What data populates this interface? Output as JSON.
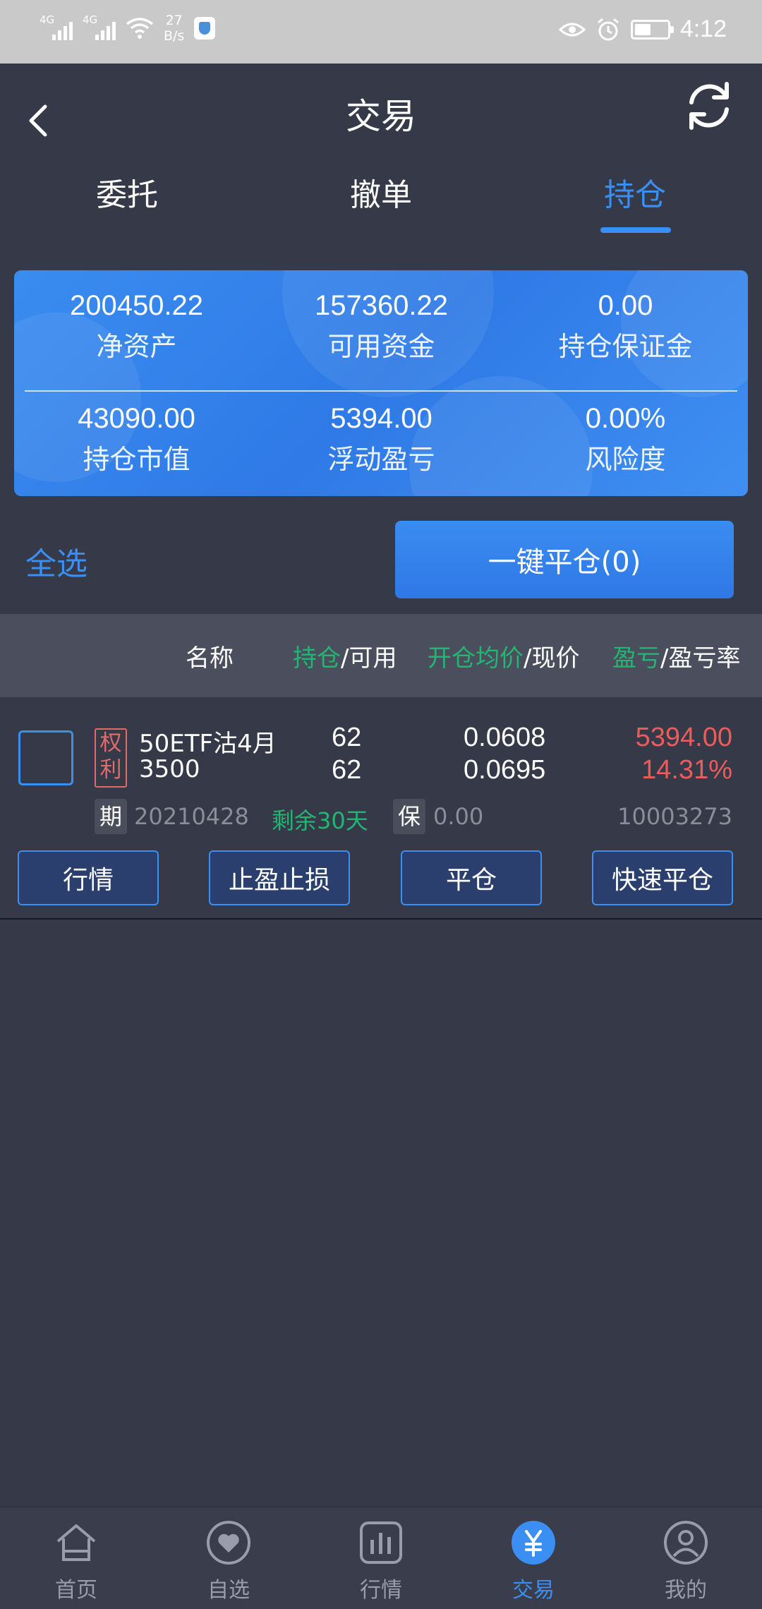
{
  "status_bar": {
    "sim1": "4G",
    "sim2": "4G",
    "net_speed_value": "27",
    "net_speed_unit": "B/s",
    "battery_level": 0.5,
    "time": "4:12"
  },
  "header": {
    "title": "交易"
  },
  "tabs": [
    {
      "label": "委托",
      "active": false
    },
    {
      "label": "撤单",
      "active": false
    },
    {
      "label": "持仓",
      "active": true
    }
  ],
  "summary": {
    "net_assets": {
      "value": "200450.22",
      "label": "净资产"
    },
    "available_funds": {
      "value": "157360.22",
      "label": "可用资金"
    },
    "position_margin": {
      "value": "0.00",
      "label": "持仓保证金"
    },
    "market_value": {
      "value": "43090.00",
      "label": "持仓市值"
    },
    "floating_pnl": {
      "value": "5394.00",
      "label": "浮动盈亏"
    },
    "risk_level": {
      "value": "0.00%",
      "label": "风险度"
    }
  },
  "actions": {
    "select_all": "全选",
    "close_all": "一键平仓(0)"
  },
  "table_header": {
    "name": "名称",
    "position_green": "持仓",
    "position_rest": "/可用",
    "open_avg_green": "开仓均价",
    "open_avg_rest": "/现价",
    "pnl_green": "盈亏",
    "pnl_rest": "/盈亏率"
  },
  "positions": [
    {
      "type_tag": [
        "权",
        "利"
      ],
      "name_line1": "50ETF沽4月",
      "name_line2": "3500",
      "holding": "62",
      "available": "62",
      "open_avg_price": "0.0608",
      "current_price": "0.0695",
      "pnl": "5394.00",
      "pnl_rate": "14.31%",
      "expiry_tag": "期",
      "expiry_date": "20210428",
      "days_left": "剩余30天",
      "margin_tag": "保",
      "margin": "0.00",
      "contract_code": "10003273",
      "buttons": [
        "行情",
        "止盈止损",
        "平仓",
        "快速平仓"
      ]
    }
  ],
  "bottom_nav": [
    {
      "label": "首页",
      "icon": "home-icon",
      "active": false
    },
    {
      "label": "自选",
      "icon": "heart-icon",
      "active": false
    },
    {
      "label": "行情",
      "icon": "bar-chart-icon",
      "active": false
    },
    {
      "label": "交易",
      "icon": "yuan-icon",
      "active": true
    },
    {
      "label": "我的",
      "icon": "user-icon",
      "active": false
    }
  ],
  "colors": {
    "background": "#363947",
    "accent_blue": "#3b8ef2",
    "profit_red": "#ee5b5b",
    "highlight_green": "#22b573"
  }
}
